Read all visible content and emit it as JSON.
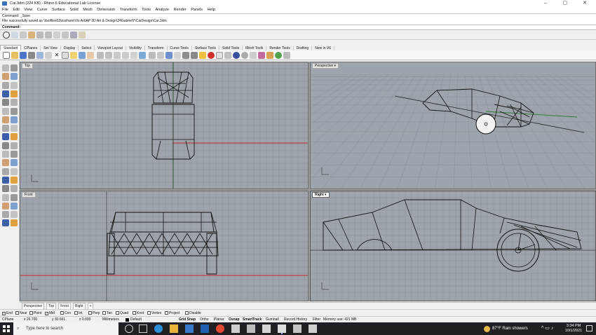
{
  "window": {
    "title": "Car.3dm (224 KB) - Rhino 6 Educational Lab License"
  },
  "menu": [
    "File",
    "Edit",
    "View",
    "Curve",
    "Surface",
    "Solid",
    "Mesh",
    "Dimension",
    "Transform",
    "Tools",
    "Analyze",
    "Render",
    "Panels",
    "Help"
  ],
  "command_history": [
    "Command: _Save",
    "File successfully saved as \\\\tsofiles03\\nsshare\\Vis Art\\AP 3D Art & Design\\24GabrielY\\CarDesign\\Car.3dm."
  ],
  "command_prompt": "Command:",
  "toolbar_tabs": [
    "Standard",
    "CPlanes",
    "Set View",
    "Display",
    "Select",
    "Viewport Layout",
    "Visibility",
    "Transform",
    "Curve Tools",
    "Surface Tools",
    "Solid Tools",
    "Mesh Tools",
    "Render Tools",
    "Drafting",
    "New in V6"
  ],
  "active_toolbar_tab": "Standard",
  "viewports": {
    "top": "Top",
    "perspective": "Perspective",
    "front": "Front",
    "right": "Right",
    "arrow": "▾"
  },
  "viewport_tabs": [
    "Perspective",
    "Top",
    "Front",
    "Right"
  ],
  "viewport_tab_add": "+",
  "osnaps": [
    {
      "label": "End",
      "checked": true
    },
    {
      "label": "Near",
      "checked": false
    },
    {
      "label": "Point",
      "checked": false
    },
    {
      "label": "Mid",
      "checked": true
    },
    {
      "label": "Cen",
      "checked": false
    },
    {
      "label": "Int",
      "checked": false
    },
    {
      "label": "Perp",
      "checked": false
    },
    {
      "label": "Tan",
      "checked": false
    },
    {
      "label": "Quad",
      "checked": false
    },
    {
      "label": "Knot",
      "checked": false
    },
    {
      "label": "Vertex",
      "checked": false
    },
    {
      "label": "Project",
      "checked": false
    },
    {
      "label": "Disable",
      "checked": false
    }
  ],
  "status": {
    "cplane": "CPlane",
    "x": "x 26.700",
    "y": "y 30.661",
    "z": "z 0.000",
    "units": "Millimeters",
    "layer": "Default",
    "grid_snap": "Grid Snap",
    "ortho": "Ortho",
    "planar": "Planar",
    "osnap": "Osnap",
    "smarttrack": "SmartTrack",
    "gumball": "Gumball",
    "record_history": "Record History",
    "filter": "Filter",
    "memory": "Memory use: 421 MB"
  },
  "taskbar": {
    "search_placeholder": "Type here to search",
    "weather": "87°F  Rain showers",
    "time": "3:34 PM",
    "date": "10/1/2021"
  },
  "colors": {
    "viewport_bg": "#9ea4ab",
    "grid": "#8c9299",
    "x_axis": "#c62828",
    "y_axis": "#2e7d32",
    "wire": "#111111"
  }
}
